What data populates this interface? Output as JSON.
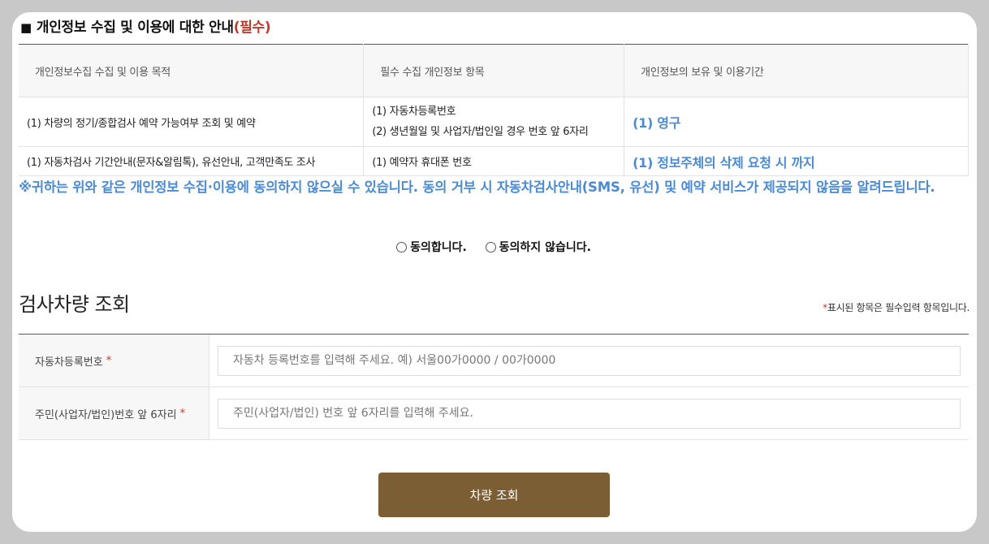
{
  "consent": {
    "title_main": "개인정보 수집 및 이용에 대한 안내",
    "title_required": "(필수)",
    "table": {
      "headers": [
        "개인정보수집 수집 및 이용 목적",
        "필수 수집 개인정보 항목",
        "개인정보의 보유 및 이용기간"
      ],
      "rows": [
        {
          "purpose": "(1) 차량의 정기/종합검사 예약 가능여부 조회 및 예약",
          "items": [
            "(1) 자동차등록번호",
            "(2) 생년월일 및 사업자/법인일 경우 번호 앞 6자리"
          ],
          "period": "(1) 영구"
        },
        {
          "purpose": "(1) 자동차검사 기간안내(문자&알림톡), 유선안내, 고객만족도 조사",
          "items": [
            "(1) 예약자 휴대폰 번호"
          ],
          "period": "(1) 정보주체의 삭제 요청 시 까지"
        }
      ]
    },
    "notice": "※귀하는 위와 같은 개인정보 수집·이용에 동의하지 않으실 수 있습니다. 동의 거부 시 자동차검사안내(SMS, 유선) 및 예약 서비스가 제공되지 않음을 알려드립니다.",
    "options": {
      "agree": "동의합니다.",
      "disagree": "동의하지 않습니다."
    }
  },
  "search": {
    "title": "검사차량 조회",
    "required_note_star": "*",
    "required_note": "표시된 항목은 필수입력 항목입니다.",
    "fields": [
      {
        "label": "자동차등록번호",
        "star": "*",
        "value": "",
        "placeholder": "자동차 등록번호를 입력해 주세요. 예) 서울00가0000 / 00가0000"
      },
      {
        "label": "주민(사업자/법인)번호 앞 6자리",
        "star": "*",
        "value": "",
        "placeholder": "주민(사업자/법인) 번호 앞 6자리를 입력해 주세요."
      }
    ],
    "submit_label": "차량 조회"
  },
  "colors": {
    "accent_blue": "#4a8bd4",
    "required_red": "#c0392b",
    "button_brown": "#7c5e34"
  }
}
